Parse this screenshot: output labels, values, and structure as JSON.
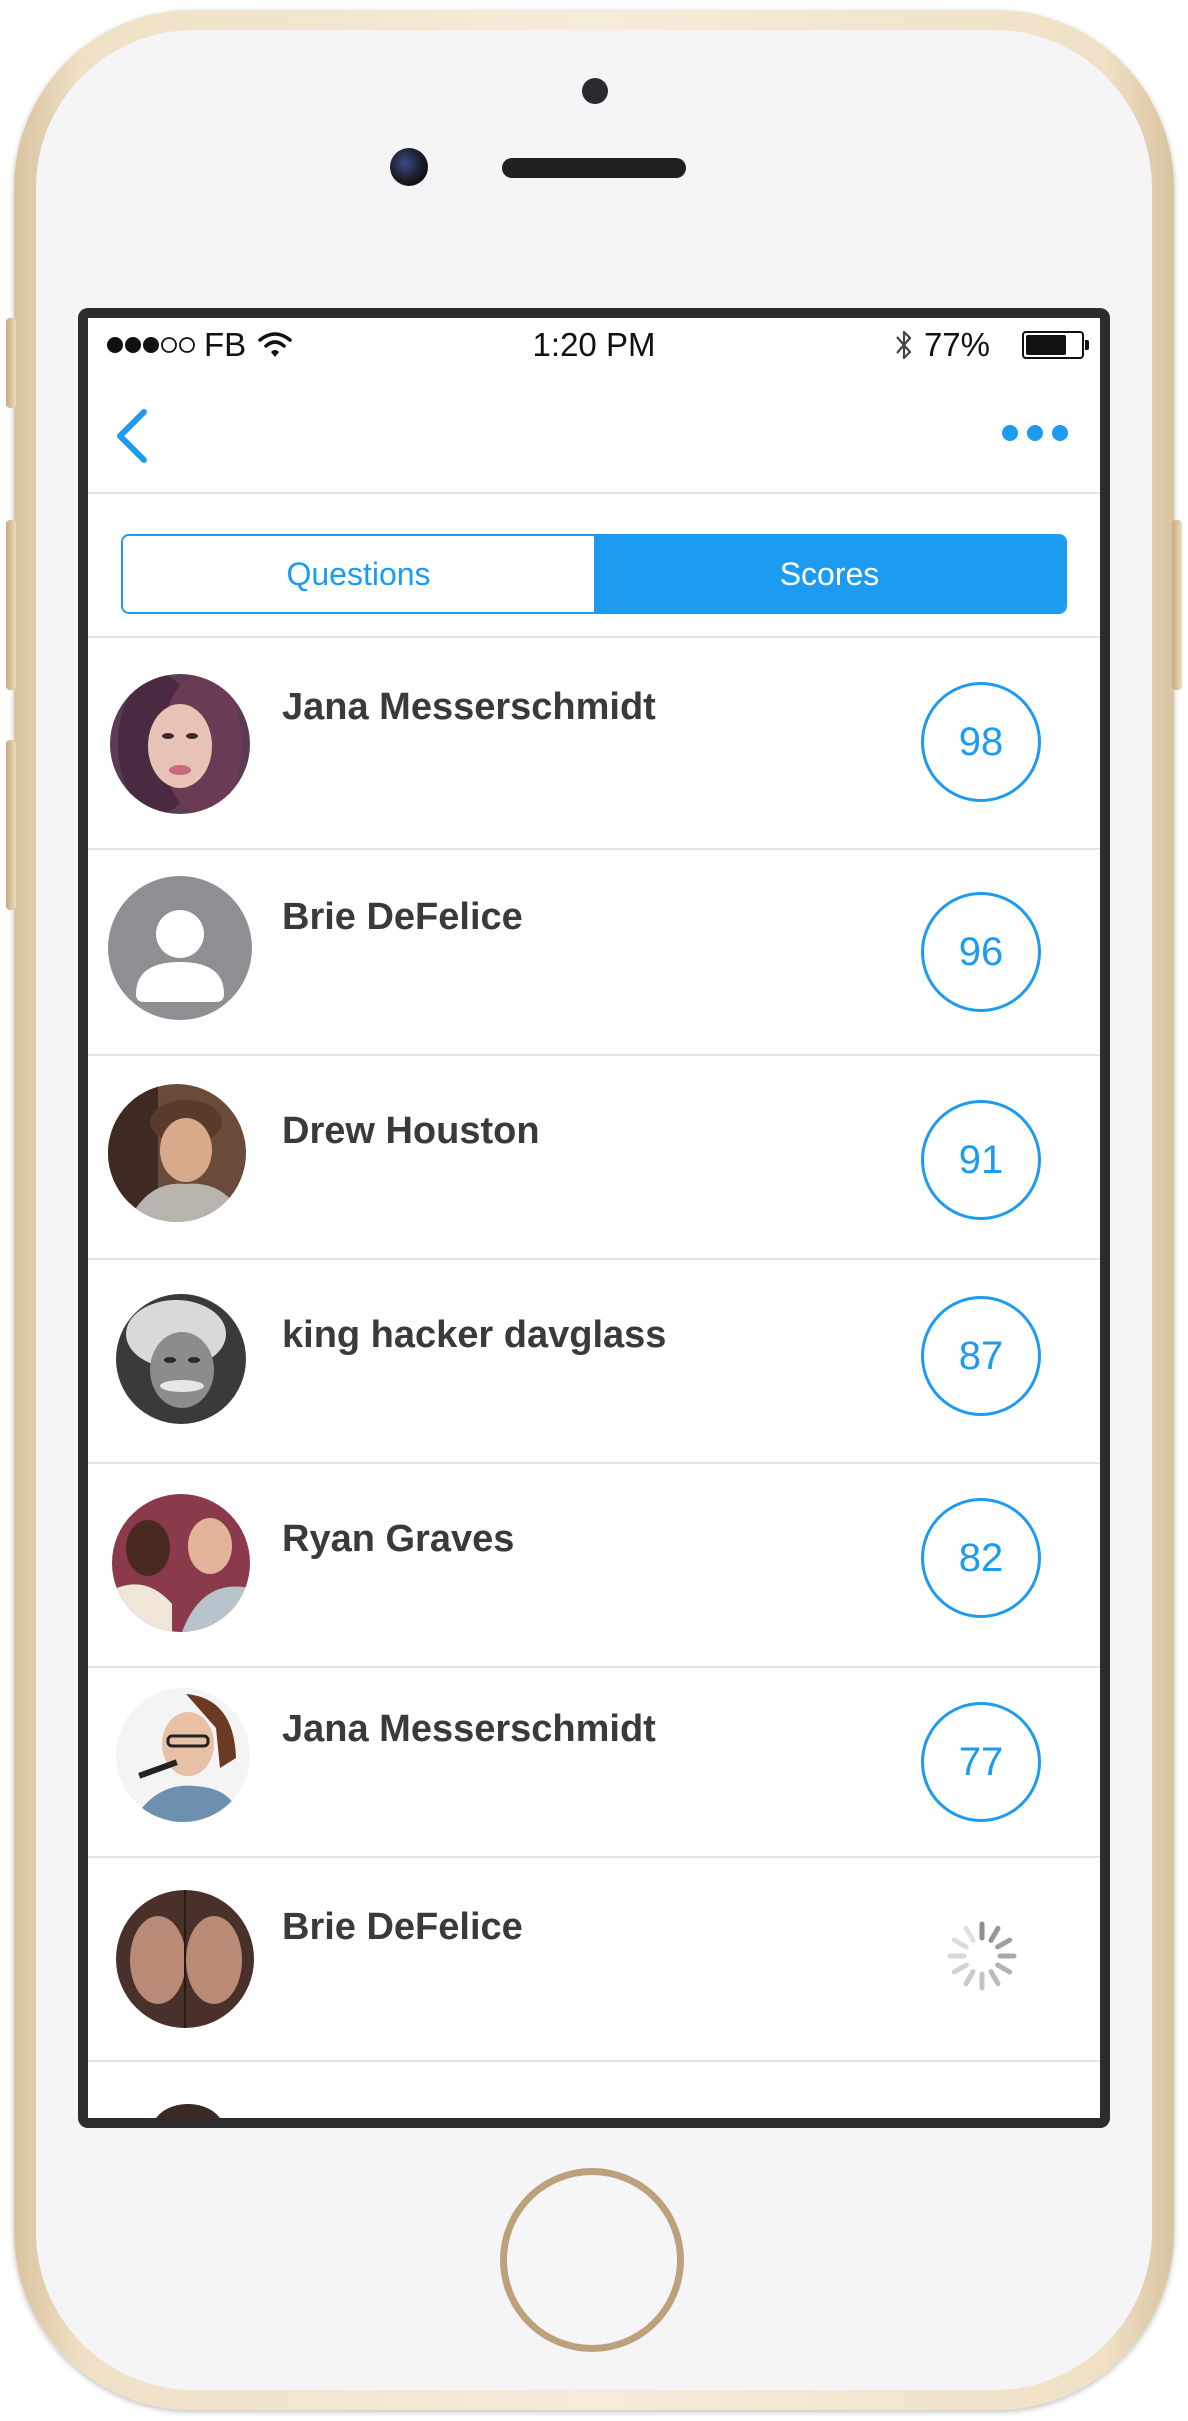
{
  "status_bar": {
    "carrier": "FB",
    "time": "1:20 PM",
    "battery_percent": "77%",
    "battery_level": 0.77,
    "signal_bars_filled": 3,
    "signal_bars_total": 5
  },
  "nav": {
    "back_icon": "chevron-left-icon",
    "more_icon": "ellipsis-icon"
  },
  "tabs": [
    {
      "label": "Questions",
      "active": false
    },
    {
      "label": "Scores",
      "active": true
    }
  ],
  "players": [
    {
      "name": "Jana Messerschmidt",
      "score": "98",
      "avatar": "photo-avatar"
    },
    {
      "name": "Brie DeFelice",
      "score": "96",
      "avatar": "placeholder-avatar"
    },
    {
      "name": "Drew Houston",
      "score": "91",
      "avatar": "photo-avatar"
    },
    {
      "name": "king hacker davglass",
      "score": "87",
      "avatar": "photo-avatar"
    },
    {
      "name": "Ryan Graves",
      "score": "82",
      "avatar": "photo-avatar"
    },
    {
      "name": "Jana Messerschmidt",
      "score": "77",
      "avatar": "photo-avatar"
    },
    {
      "name": "Brie DeFelice",
      "score": "",
      "avatar": "photo-avatar",
      "loading": true
    }
  ],
  "colors": {
    "accent": "#1d9bf0",
    "name_text": "#3a3a3c",
    "divider": "#e3e3e6"
  }
}
